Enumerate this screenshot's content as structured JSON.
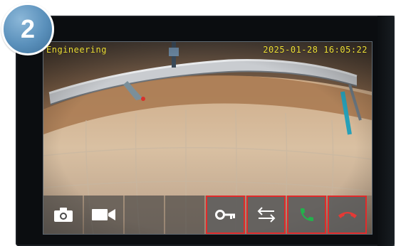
{
  "badge": {
    "number": "2"
  },
  "screen": {
    "camera_label": "Engineering",
    "timestamp": "2025-01-28 16:05:22"
  },
  "controls": {
    "icons": [
      "camera-icon",
      "video-camera-icon",
      "key-icon",
      "switch-arrows-icon",
      "answer-call-icon",
      "hang-up-icon"
    ]
  },
  "colors": {
    "overlay_text": "#f2e33a",
    "badge_fill": "#5a90bb",
    "highlight_outline": "#e02b2b",
    "answer_green": "#22b24c",
    "hangup_red": "#e53935"
  }
}
